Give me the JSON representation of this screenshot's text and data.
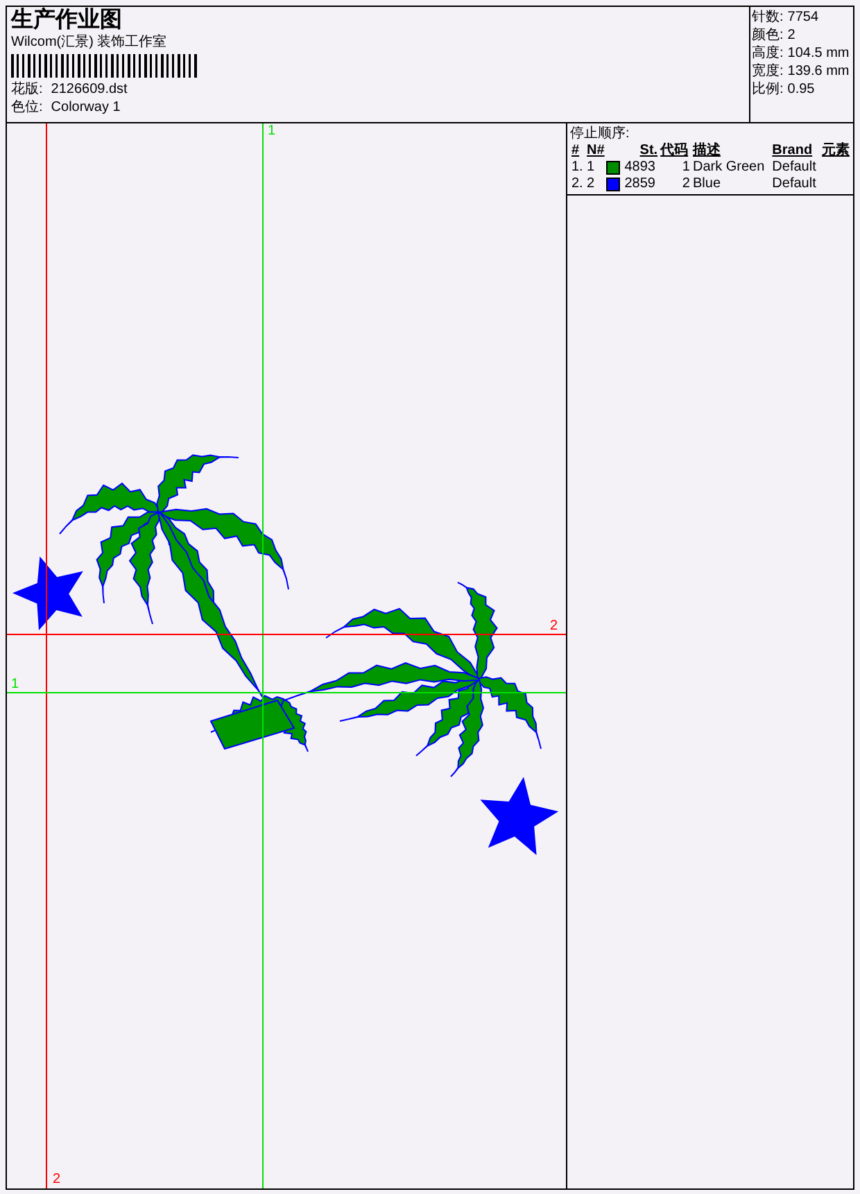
{
  "header": {
    "title": "生产作业图",
    "company": "Wilcom(汇景) 装饰工作室",
    "fields": [
      {
        "label": "花版:",
        "value": "2126609.dst"
      },
      {
        "label": "色位:",
        "value": "Colorway 1"
      }
    ]
  },
  "stats": [
    {
      "label": "针数:",
      "value": "7754"
    },
    {
      "label": "颜色:",
      "value": "2"
    },
    {
      "label": "高度:",
      "value": "104.5 mm"
    },
    {
      "label": "宽度:",
      "value": "139.6 mm"
    },
    {
      "label": "比例:",
      "value": "0.95"
    }
  ],
  "stop_sequence": {
    "title": "停止顺序:",
    "columns": [
      "#",
      "N#",
      "St.",
      "代码",
      "描述",
      "Brand",
      "元素"
    ],
    "rows": [
      {
        "seq": "1.",
        "n": "1",
        "color": "#008c00",
        "stitches": "4893",
        "code": "1",
        "description": "Dark Green",
        "brand": "Default"
      },
      {
        "seq": "2.",
        "n": "2",
        "color": "#0000ff",
        "stitches": "2859",
        "code": "2",
        "description": "Blue",
        "brand": "Default"
      }
    ]
  },
  "guides": [
    {
      "kind": "vertical",
      "color": "#ff0000",
      "label": "2"
    },
    {
      "kind": "vertical",
      "color": "#00e000",
      "label": "1"
    },
    {
      "kind": "horizontal",
      "color": "#ff0000",
      "label": "2"
    },
    {
      "kind": "horizontal",
      "color": "#00e000",
      "label": "1"
    }
  ]
}
